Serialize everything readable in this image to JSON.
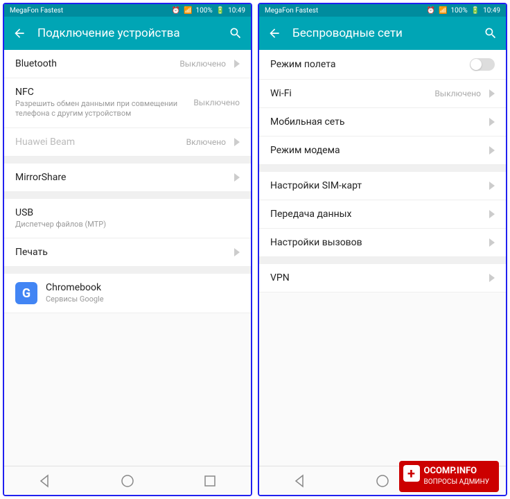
{
  "statusbar": {
    "carrier": "MegaFon Fastest",
    "battery": "100%",
    "time": "10:49"
  },
  "left": {
    "title": "Подключение устройства",
    "items": [
      {
        "title": "Bluetooth",
        "value": "Выключено",
        "chevron": true
      },
      {
        "title": "NFC",
        "sub": "Разрешить обмен данными при совмещении телефона с другим устройством",
        "value": "Выключено"
      },
      {
        "title": "Huawei Beam",
        "value": "Включено",
        "chevron": true,
        "disabled": true
      }
    ],
    "items2": [
      {
        "title": "MirrorShare",
        "chevron": true
      }
    ],
    "items3": [
      {
        "title": "USB",
        "sub": "Диспетчер файлов (MTP)"
      },
      {
        "title": "Печать",
        "chevron": true
      }
    ],
    "items4": [
      {
        "title": "Chromebook",
        "sub": "Сервисы Google",
        "icon": "G"
      }
    ]
  },
  "right": {
    "title": "Беспроводные сети",
    "items": [
      {
        "title": "Режим полета",
        "toggle": true
      },
      {
        "title": "Wi-Fi",
        "value": "Выключено",
        "chevron": true
      },
      {
        "title": "Мобильная сеть",
        "chevron": true
      },
      {
        "title": "Режим модема",
        "chevron": true
      }
    ],
    "items2": [
      {
        "title": "Настройки SIM-карт",
        "chevron": true
      },
      {
        "title": "Передача данных",
        "chevron": true
      },
      {
        "title": "Настройки вызовов",
        "chevron": true
      }
    ],
    "items3": [
      {
        "title": "VPN",
        "chevron": true
      }
    ]
  },
  "watermark": {
    "title": "OCOMP.INFO",
    "sub": "ВОПРОСЫ АДМИНУ"
  }
}
